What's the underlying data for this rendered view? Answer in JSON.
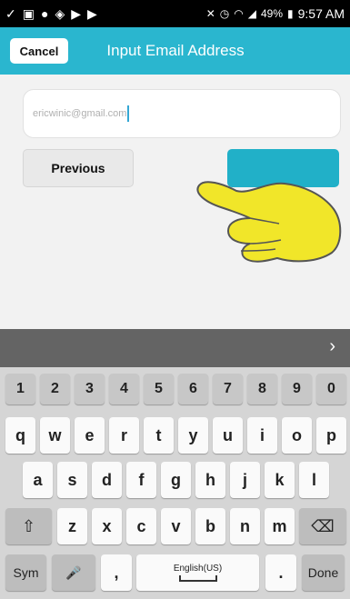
{
  "status_bar": {
    "battery": "49%",
    "time": "9:57 AM"
  },
  "header": {
    "cancel": "Cancel",
    "title": "Input Email Address"
  },
  "email": {
    "value": "ericwinic@gmail.com"
  },
  "buttons": {
    "previous": "Previous"
  },
  "keyboard": {
    "arrow": "›",
    "row_numbers": [
      "1",
      "2",
      "3",
      "4",
      "5",
      "6",
      "7",
      "8",
      "9",
      "0"
    ],
    "row_q": [
      "q",
      "w",
      "e",
      "r",
      "t",
      "y",
      "u",
      "i",
      "o",
      "p"
    ],
    "row_a": [
      "a",
      "s",
      "d",
      "f",
      "g",
      "h",
      "j",
      "k",
      "l"
    ],
    "row_z": [
      "z",
      "x",
      "c",
      "v",
      "b",
      "n",
      "m"
    ],
    "shift": "⇧",
    "backspace": "⌫",
    "sym": "Sym",
    "mic": "🎤",
    "comma": ",",
    "space": "English(US)",
    "period": ".",
    "done": "Done"
  },
  "colors": {
    "header": "#2ab6cf",
    "next_button": "#21b0c8",
    "hand": "#f1e629"
  }
}
